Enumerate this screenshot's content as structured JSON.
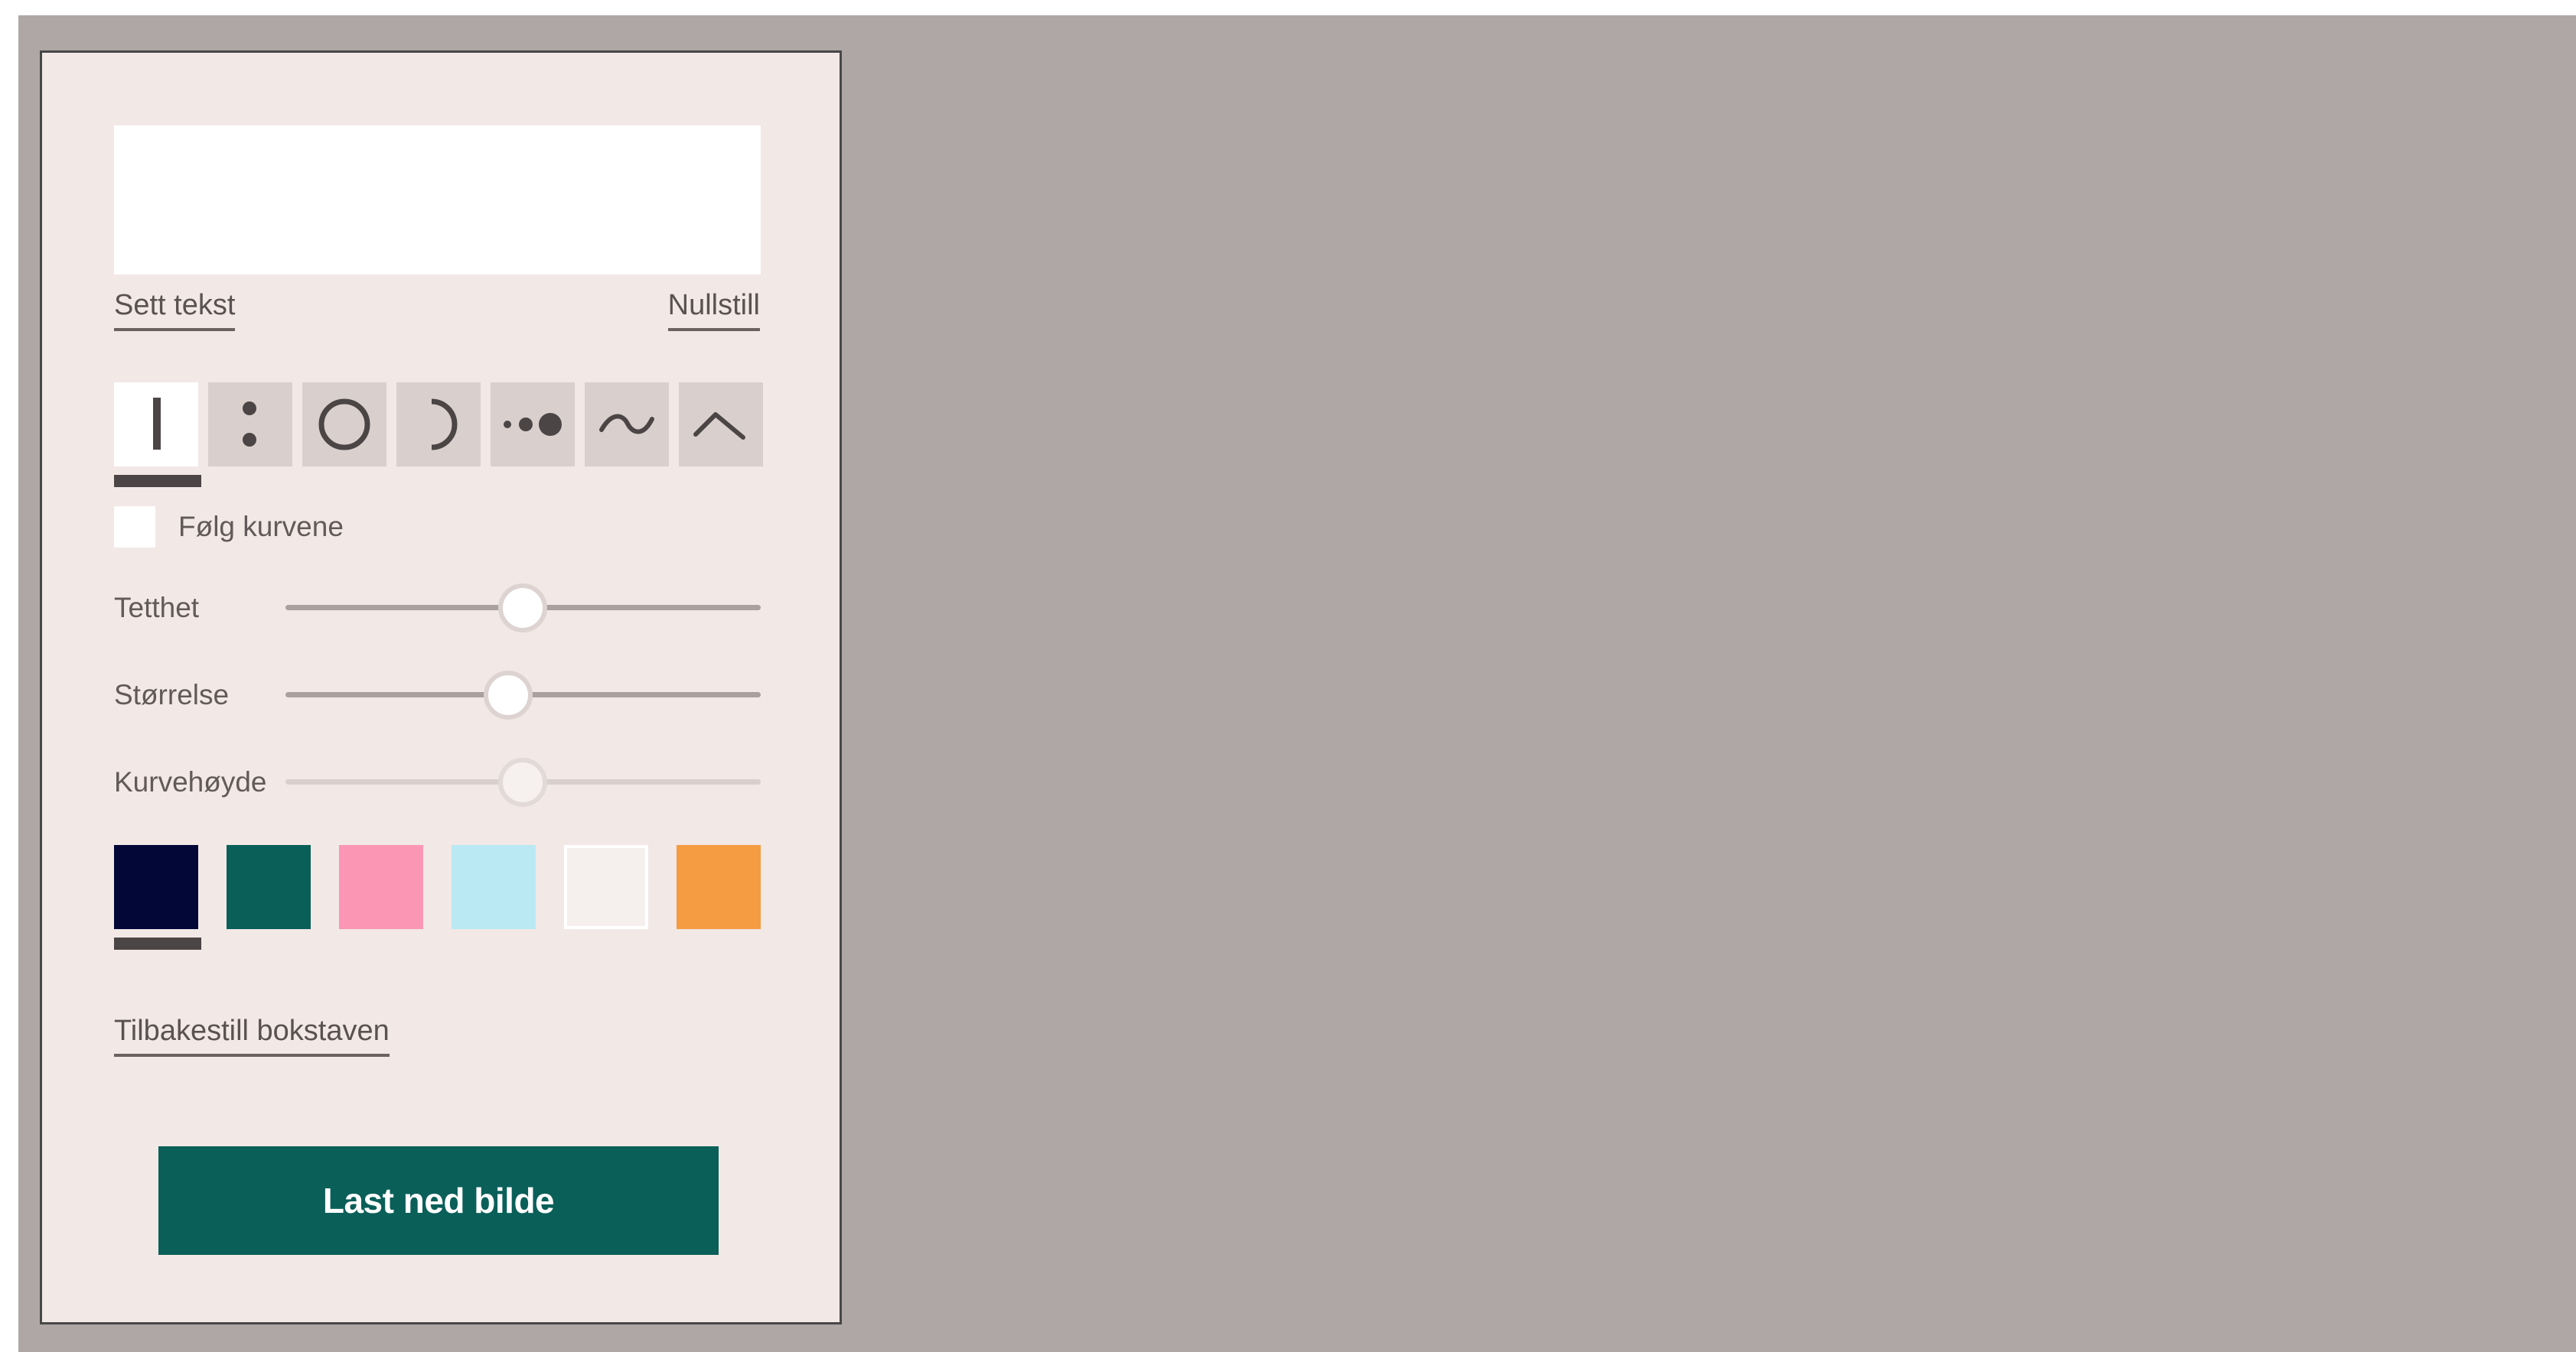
{
  "text_field": {
    "value": "",
    "placeholder": ""
  },
  "links": {
    "set_text": "Sett tekst",
    "reset": "Nullstill",
    "reset_letter": "Tilbakestill bokstaven"
  },
  "stroke_tools": {
    "selected": "line-stroke-icon",
    "items": [
      "line-stroke-icon",
      "colon-dots-icon",
      "circle-icon",
      "arc-icon",
      "graduated-dots-icon",
      "wave-icon",
      "peak-icon"
    ]
  },
  "follow_curves": {
    "label": "Følg kurvene",
    "checked": false
  },
  "sliders": {
    "density": {
      "label": "Tetthet",
      "value": 0.5,
      "enabled": true
    },
    "size": {
      "label": "Størrelse",
      "value": 0.47,
      "enabled": true
    },
    "curve_height": {
      "label": "Kurvehøyde",
      "value": 0.5,
      "enabled": false
    }
  },
  "colors": {
    "selected": "#020738",
    "swatches": [
      "#020738",
      "#0a5f59",
      "#fb96b5",
      "#bae9f4",
      "#f5efee",
      "#f59c43"
    ]
  },
  "download_button": {
    "label": "Last ned bilde"
  }
}
